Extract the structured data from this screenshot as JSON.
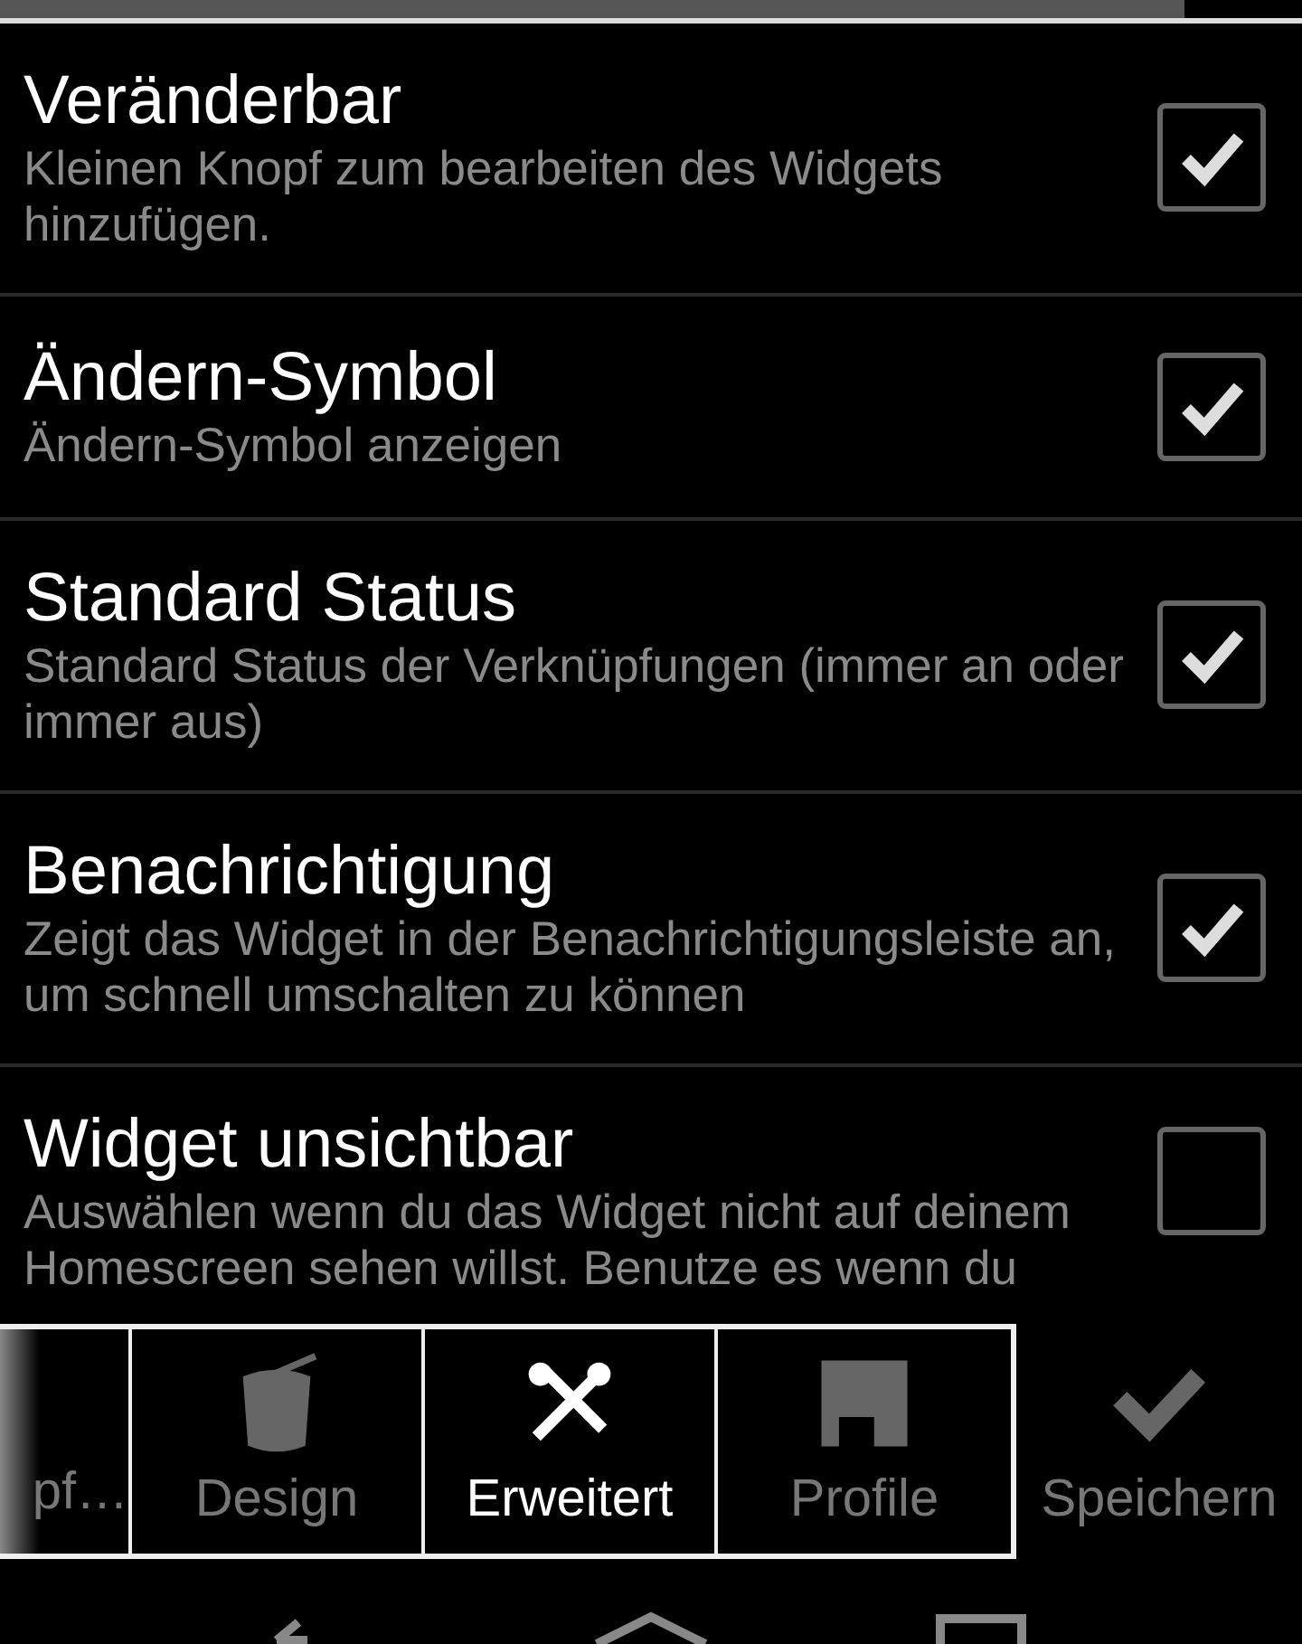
{
  "settings": [
    {
      "title": "Veränderbar",
      "description": "Kleinen Knopf zum bearbeiten des Widgets hinzufügen.",
      "checked": true
    },
    {
      "title": "Ändern-Symbol",
      "description": "Ändern-Symbol anzeigen",
      "checked": true
    },
    {
      "title": "Standard Status",
      "description": "Standard Status der Verknüpfungen (immer an oder immer aus)",
      "checked": true
    },
    {
      "title": "Benachrichtigung",
      "description": "Zeigt das Widget in der Benachrichtigungsleiste an, um schnell umschalten zu können",
      "checked": true
    },
    {
      "title": "Widget unsichtbar",
      "description": "Auswählen wenn du das Widget nicht auf deinem Homescreen sehen willst. Benutze es wenn du",
      "checked": false
    }
  ],
  "tabs": [
    {
      "label": "pf…",
      "kind": "cut",
      "selected": false
    },
    {
      "label": "Design",
      "kind": "bucket",
      "selected": false
    },
    {
      "label": "Erweitert",
      "kind": "tools",
      "selected": true
    },
    {
      "label": "Profile",
      "kind": "disk",
      "selected": false
    }
  ],
  "action": {
    "label": "Speichern"
  }
}
